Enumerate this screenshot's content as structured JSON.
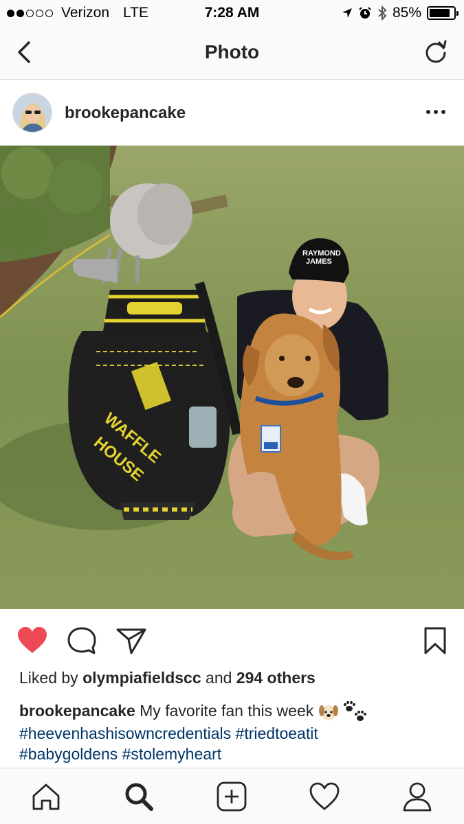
{
  "status_bar": {
    "carrier": "Verizon",
    "network": "LTE",
    "time": "7:28 AM",
    "battery": "85%",
    "battery_level": 0.85,
    "signal_bars_filled": 2,
    "signal_bars_total": 5,
    "icons": [
      "location-arrow-icon",
      "alarm-icon",
      "bluetooth-icon",
      "battery-icon"
    ]
  },
  "nav": {
    "title": "Photo",
    "icons": [
      "back-chevron-icon",
      "refresh-icon"
    ]
  },
  "post": {
    "username": "brookepancake",
    "icons": [
      "more-options-icon"
    ],
    "photo_description_icons": [
      "golf-bag",
      "waffle-house-logo",
      "golden-retriever-puppy"
    ],
    "photo_text": {
      "bag_brand_line1": "WAFFLE",
      "bag_brand_line2": "HOUSE",
      "cap_text_line1": "RAYMOND",
      "cap_text_line2": "JAMES"
    },
    "actions": {
      "icons": [
        "heart-filled-icon",
        "comment-icon",
        "share-icon",
        "bookmark-icon"
      ],
      "liked": true,
      "like_color": "#ed4956"
    },
    "likes": {
      "prefix": "Liked by",
      "user": "olympiafieldscc",
      "middle": "and",
      "others": "294 others"
    },
    "caption": {
      "username": "brookepancake",
      "text": "My favorite fan this week",
      "emojis": [
        "dog-face-icon",
        "paw-prints-icon"
      ],
      "hashtags": [
        "#heevenhashisowncredentials",
        "#triedtoeatit",
        "#babygoldens",
        "#stolemyheart"
      ]
    }
  },
  "tab_bar": {
    "icons": [
      "home-icon",
      "search-icon",
      "add-post-icon",
      "activity-heart-icon",
      "profile-icon"
    ],
    "active": "search-icon"
  },
  "colors": {
    "hashtag": "#003569",
    "bar_background": "#fafafa",
    "divider": "#dbdbdb"
  }
}
